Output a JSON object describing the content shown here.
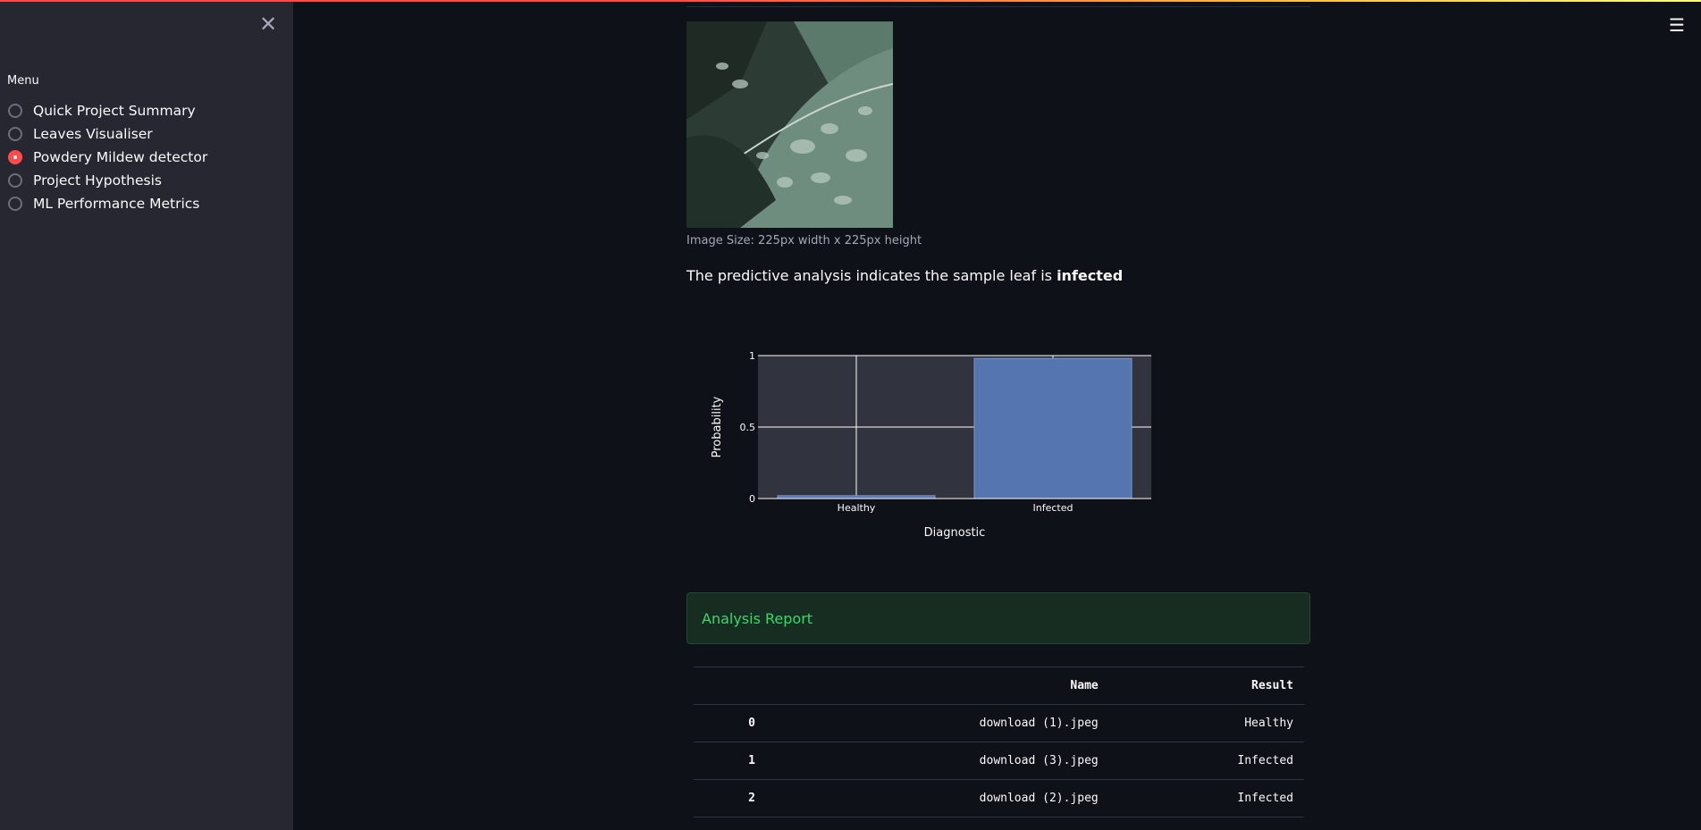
{
  "sidebar": {
    "close_icon": "close-icon",
    "menu_label": "Menu",
    "items": [
      {
        "label": "Quick Project Summary",
        "selected": false
      },
      {
        "label": "Leaves Visualiser",
        "selected": false
      },
      {
        "label": "Powdery Mildew detector",
        "selected": true
      },
      {
        "label": "Project Hypothesis",
        "selected": false
      },
      {
        "label": "ML Performance Metrics",
        "selected": false
      }
    ]
  },
  "header": {
    "menu_icon": "hamburger-menu-icon"
  },
  "main": {
    "image_caption": "Image Size: 225px width x 225px height",
    "prediction_prefix": "The predictive analysis indicates the sample leaf is ",
    "prediction_result": "infected",
    "analysis_title": "Analysis Report",
    "table": {
      "columns": [
        "",
        "Name",
        "Result"
      ],
      "rows": [
        {
          "index": "0",
          "name": "download (1).jpeg",
          "result": "Healthy"
        },
        {
          "index": "1",
          "name": "download (3).jpeg",
          "result": "Infected"
        },
        {
          "index": "2",
          "name": "download (2).jpeg",
          "result": "Infected"
        }
      ]
    }
  },
  "chart_data": {
    "type": "bar",
    "categories": [
      "Healthy",
      "Infected"
    ],
    "values": [
      0.02,
      0.98
    ],
    "xlabel": "Diagnostic",
    "ylabel": "Probability",
    "ylim": [
      0,
      1
    ],
    "yticks": [
      "0",
      "0.5",
      "1"
    ],
    "grid": true,
    "bar_color": "#5575b0",
    "plot_bg": "#31333f"
  },
  "colors": {
    "accent": "#ff4b4b",
    "success_text": "#3dd56d",
    "background": "#0e1117",
    "sidebar": "#262730"
  }
}
